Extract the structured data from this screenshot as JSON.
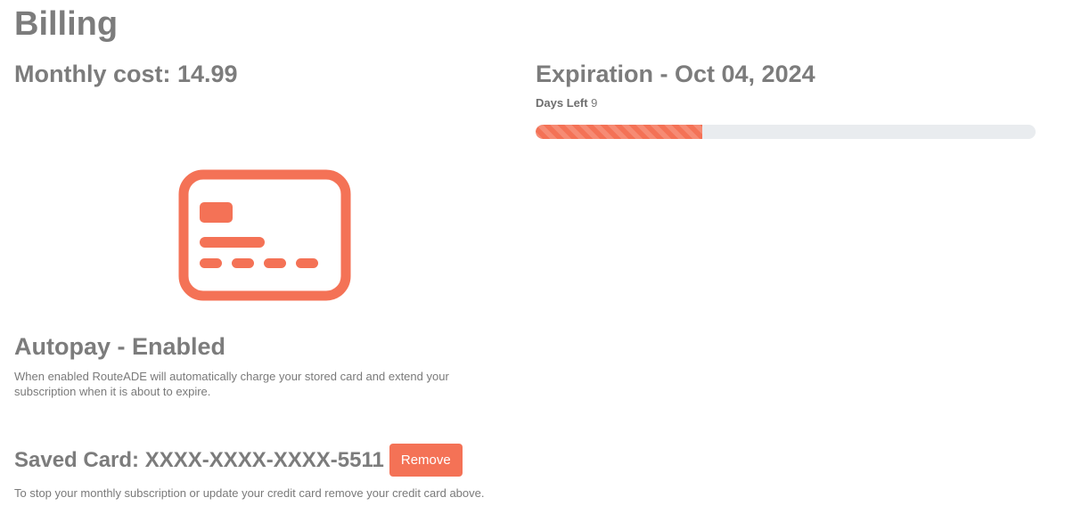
{
  "page": {
    "title": "Billing"
  },
  "billing": {
    "monthly_cost": "Monthly cost: 14.99",
    "card_icon": "credit-card-icon",
    "autopay_title": "Autopay - Enabled",
    "autopay_description": "When enabled RouteADE will automatically charge your stored card and extend your subscription when it is about to expire.",
    "saved_card_label": "Saved Card: XXXX-XXXX-XXXX-5511",
    "remove_button_label": "Remove",
    "saved_card_description": "To stop your monthly subscription or update your credit card remove your credit card above."
  },
  "expiration": {
    "title": "Expiration - Oct 04, 2024",
    "days_left_label": "Days Left",
    "days_left_value": "9",
    "progress_fraction": 0.333
  },
  "colors": {
    "accent": "#f47256",
    "text": "#7c7c7c",
    "track": "#e9ecef"
  }
}
